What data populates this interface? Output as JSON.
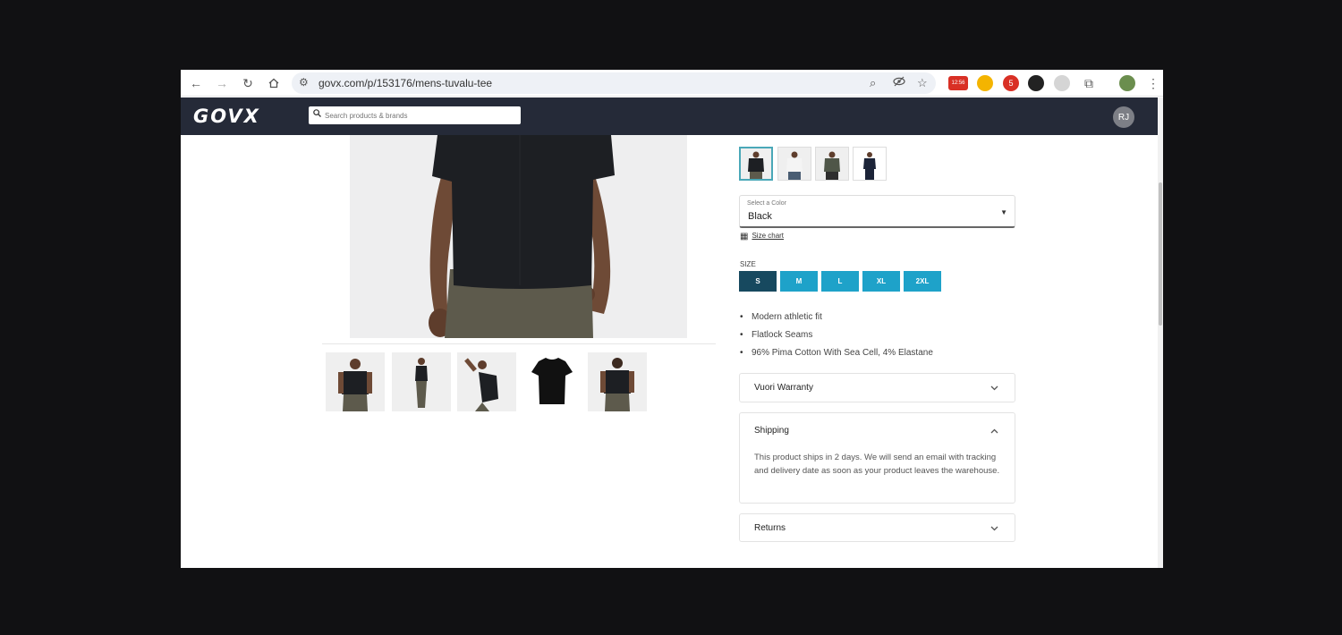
{
  "browser": {
    "url": "govx.com/p/153176/mens-tuvalu-tee",
    "extension_badges": [
      "12:56",
      "5"
    ]
  },
  "header": {
    "logo": "GOVX",
    "search_placeholder": "Search products & brands",
    "avatar_initials": "RJ"
  },
  "product": {
    "color_label": "Select a Color",
    "color_value": "Black",
    "size_chart": "Size chart",
    "size_heading": "SIZE",
    "sizes": [
      "S",
      "M",
      "L",
      "XL",
      "2XL"
    ],
    "selected_size": "S",
    "features": [
      "Modern athletic fit",
      "Flatlock Seams",
      "96% Pima Cotton With Sea Cell, 4% Elastane"
    ],
    "panels": {
      "warranty": {
        "title": "Vuori Warranty"
      },
      "shipping": {
        "title": "Shipping",
        "body": "This product ships in 2 days. We will send an email with tracking and delivery date as soon as your product leaves the warehouse."
      },
      "returns": {
        "title": "Returns"
      }
    }
  },
  "colors": {
    "header_bg": "#252a38",
    "size_button": "#1ea2c9",
    "size_button_selected": "#17495f",
    "swatch_selected_border": "#4aa8b8"
  }
}
